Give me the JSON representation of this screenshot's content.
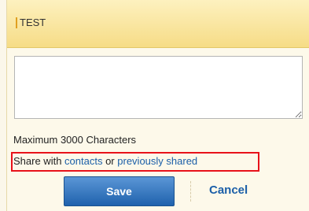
{
  "header": {
    "title": "TEST"
  },
  "comment": {
    "value": "",
    "max_label": "Maximum 3000 Characters"
  },
  "share": {
    "prefix": "Share with ",
    "contacts_link": "contacts",
    "middle": " or ",
    "previous_link": "previously shared"
  },
  "actions": {
    "save_label": "Save",
    "cancel_label": "Cancel"
  },
  "colors": {
    "header_top": "#fdf1bf",
    "header_bottom": "#f6dc86",
    "link": "#1b5fa8",
    "highlight_border": "#e8121a",
    "button": "#2f6fb8"
  }
}
